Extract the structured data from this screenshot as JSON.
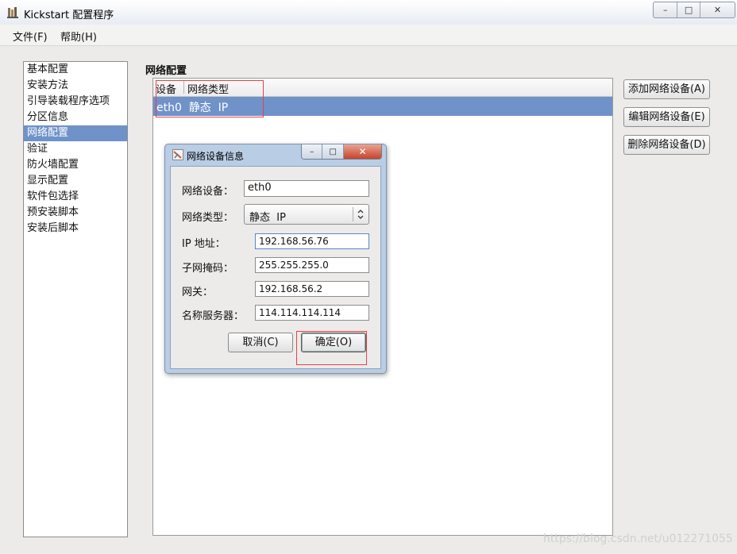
{
  "window": {
    "title": "Kickstart 配置程序",
    "controls": {
      "minimize": "–",
      "maximize": "□",
      "close": "✕"
    }
  },
  "menu": [
    {
      "label": "文件(F)"
    },
    {
      "label": "帮助(H)"
    }
  ],
  "sidebar": {
    "items": [
      {
        "label": "基本配置"
      },
      {
        "label": "安装方法"
      },
      {
        "label": "引导装载程序选项"
      },
      {
        "label": "分区信息"
      },
      {
        "label": "网络配置"
      },
      {
        "label": "验证"
      },
      {
        "label": "防火墙配置"
      },
      {
        "label": "显示配置"
      },
      {
        "label": "软件包选择"
      },
      {
        "label": "预安装脚本"
      },
      {
        "label": "安装后脚本"
      }
    ],
    "selected_index": 4
  },
  "main": {
    "section_title": "网络配置",
    "table": {
      "columns": [
        "设备",
        "网络类型"
      ],
      "rows": [
        {
          "text": "eth0  静态  IP"
        }
      ],
      "selected_index": 0
    },
    "buttons": {
      "add": "添加网络设备(A)",
      "edit": "编辑网络设备(E)",
      "delete": "删除网络设备(D)"
    }
  },
  "dialog": {
    "title": "网络设备信息",
    "controls": {
      "minimize": "–",
      "maximize": "□",
      "close": "✕"
    },
    "fields": {
      "device_label": "网络设备：",
      "device_value": "eth0",
      "type_label": "网络类型：",
      "type_value": "静态  IP",
      "ip_label": "IP 地址：",
      "ip_value": "192.168.56.76",
      "netmask_label": "子网掩码：",
      "netmask_value": "255.255.255.0",
      "gateway_label": "网关：",
      "gateway_value": "192.168.56.2",
      "dns_label": "名称服务器：",
      "dns_value": "114.114.114.114"
    },
    "buttons": {
      "cancel": "取消(C)",
      "ok": "确定(O)"
    }
  },
  "watermark": "https://blog.csdn.net/u012271055",
  "colors": {
    "selection": "#6f92c9",
    "annotation": "#e3434a",
    "dialog_frame": "#b9cde4"
  }
}
